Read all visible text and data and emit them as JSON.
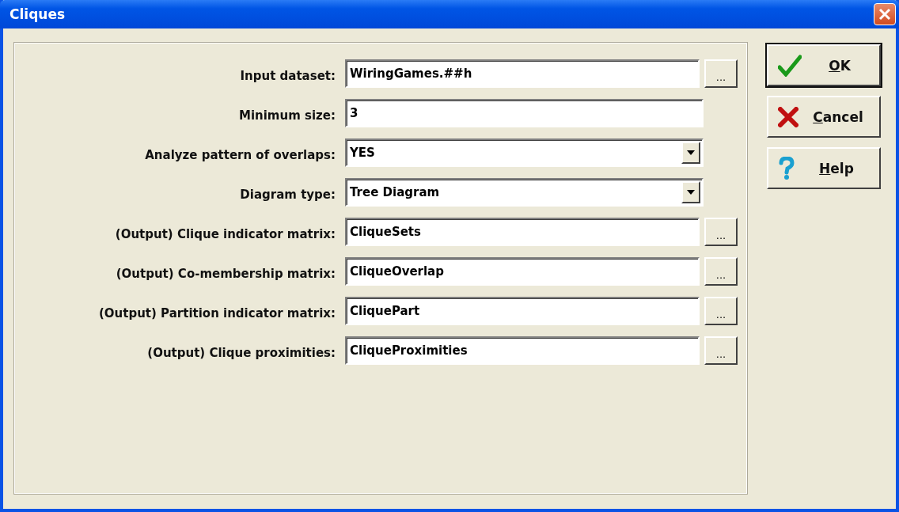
{
  "window": {
    "title": "Cliques"
  },
  "fields": [
    {
      "kind": "browse",
      "label": "Input dataset:",
      "value": "WiringGames.##h"
    },
    {
      "kind": "text",
      "label": "Minimum size:",
      "value": "3"
    },
    {
      "kind": "combo",
      "label": "Analyze pattern of overlaps:",
      "value": "YES"
    },
    {
      "kind": "combo",
      "label": "Diagram type:",
      "value": "Tree Diagram"
    },
    {
      "kind": "browse",
      "label": "(Output) Clique indicator matrix:",
      "value": "CliqueSets"
    },
    {
      "kind": "browse",
      "label": "(Output) Co-membership matrix:",
      "value": "CliqueOverlap"
    },
    {
      "kind": "browse",
      "label": "(Output) Partition indicator matrix:",
      "value": "CliquePart"
    },
    {
      "kind": "browse",
      "label": "(Output) Clique proximities:",
      "value": "CliqueProximities"
    }
  ],
  "browse_label": "...",
  "buttons": [
    {
      "kind": "ok",
      "key": "O",
      "rest": "K",
      "default": true
    },
    {
      "kind": "cancel",
      "key": "C",
      "rest": "ancel",
      "default": false
    },
    {
      "kind": "help",
      "key": "H",
      "rest": "elp",
      "default": false
    }
  ]
}
